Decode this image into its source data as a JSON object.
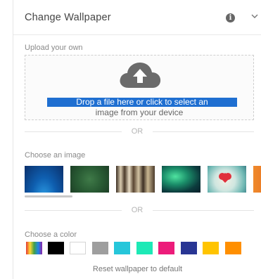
{
  "header": {
    "title": "Change Wallpaper",
    "info_icon": "info-icon",
    "info_glyph": "i",
    "collapse_icon": "chevron-down-icon"
  },
  "upload": {
    "label": "Upload your own",
    "icon": "cloud-upload-icon",
    "line1": "Drop a file here or click to select an",
    "line2": "image from your device"
  },
  "dividers": {
    "or_text": "OR"
  },
  "images": {
    "label": "Choose an image",
    "thumbnails": [
      "blue-ocean",
      "green-texture",
      "forest-trees",
      "aurora-green",
      "heart-balloon",
      "orange-partial"
    ]
  },
  "colors": {
    "label": "Choose a color",
    "swatches": [
      "rainbow",
      "#000000",
      "#ffffff",
      "#9e9e9e",
      "#26c6da",
      "#1de9b6",
      "#ec1c7a",
      "#283593",
      "#ffc400",
      "#ff8f00"
    ]
  },
  "reset": {
    "label": "Reset wallpaper to default"
  }
}
